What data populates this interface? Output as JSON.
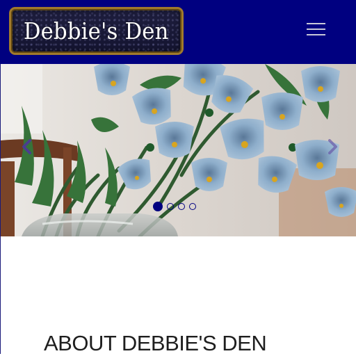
{
  "header": {
    "logo_text": "Debbie's Den",
    "menu_icon": "hamburger-menu-icon",
    "background_color": "#000080"
  },
  "carousel": {
    "slide_count": 4,
    "active_slide": 1,
    "prev_icon": "chevron-left-icon",
    "next_icon": "chevron-right-icon",
    "indicator_color": "#000080"
  },
  "about": {
    "heading": "ABOUT DEBBIE'S DEN"
  }
}
